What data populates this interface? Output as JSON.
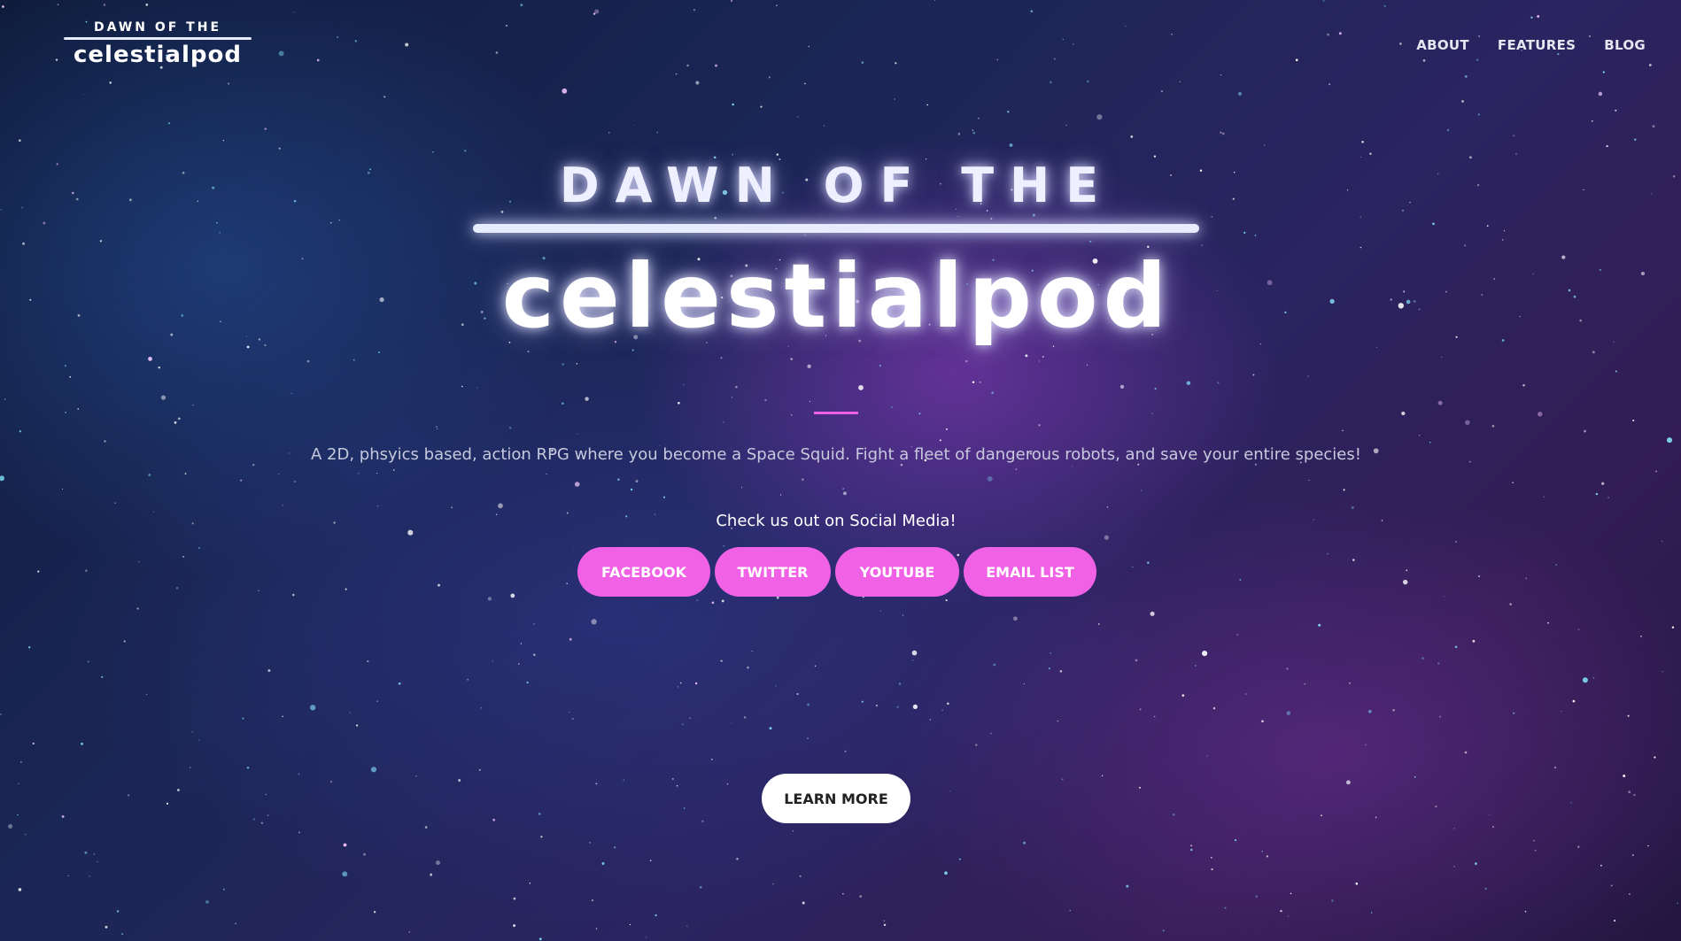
{
  "nav": {
    "logo_top": "DAWN OF THE",
    "logo_bottom": "celestialpod",
    "links": [
      "ABOUT",
      "FEATURES",
      "BLOG"
    ]
  },
  "hero": {
    "title_top": "DAWN OF THE",
    "title_bottom": "celestialpod",
    "tagline": "A 2D, phsyics based, action RPG where you become a Space Squid. Fight a fleet of dangerous robots, and save your entire species!",
    "social_heading": "Check us out on Social Media!",
    "social_buttons": [
      "FACEBOOK",
      "TWITTER",
      "YOUTUBE",
      "EMAIL LIST"
    ],
    "learn_more": "LEARN MORE"
  },
  "colors": {
    "accent_pink": "#f061e6",
    "background_navy": "#1b2656",
    "background_purple": "#331d55"
  }
}
